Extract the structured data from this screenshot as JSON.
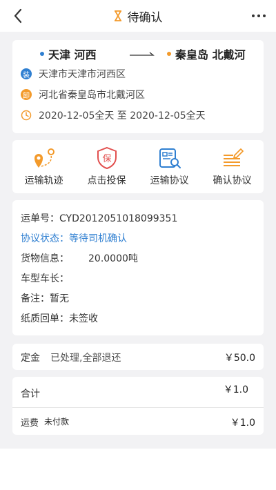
{
  "header": {
    "title": "待确认",
    "back_icon": "chevron-left-icon",
    "title_icon": "hourglass-icon",
    "more_icon": "more-dots-icon"
  },
  "route": {
    "from": "天津 河西",
    "to": "秦皇岛 北戴河",
    "load_badge": "装",
    "load_address": "天津市天津市河西区",
    "unload_badge": "卸",
    "unload_address": "河北省秦皇岛市北戴河区",
    "date_range": "2020-12-05全天 至 2020-12-05全天"
  },
  "actions": [
    {
      "label": "运输轨迹",
      "icon": "location-track-icon"
    },
    {
      "label": "点击投保",
      "icon": "insurance-shield-icon"
    },
    {
      "label": "运输协议",
      "icon": "document-search-icon"
    },
    {
      "label": "确认协议",
      "icon": "edit-confirm-icon"
    }
  ],
  "order": {
    "waybill": "运单号：CYD2012051018099351",
    "agreement_status": "协议状态：等待司机确认",
    "cargo_label": "货物信息：",
    "cargo_value": "20.0000吨",
    "vehicle": "车型车长：",
    "remark": "备注：暂无",
    "receipt": "纸质回单：未签收"
  },
  "deposit": {
    "label": "定金",
    "status": "已处理,全部退还",
    "amount": "￥50.0"
  },
  "totals": {
    "sum_label": "合计",
    "sum_amount": "￥1.0",
    "fee_label": "运费",
    "fee_status": "未付款",
    "fee_amount": "￥1.0"
  },
  "colors": {
    "accent_orange": "#f39a2b",
    "accent_blue": "#2f7fd1",
    "accent_red": "#e2504f"
  }
}
